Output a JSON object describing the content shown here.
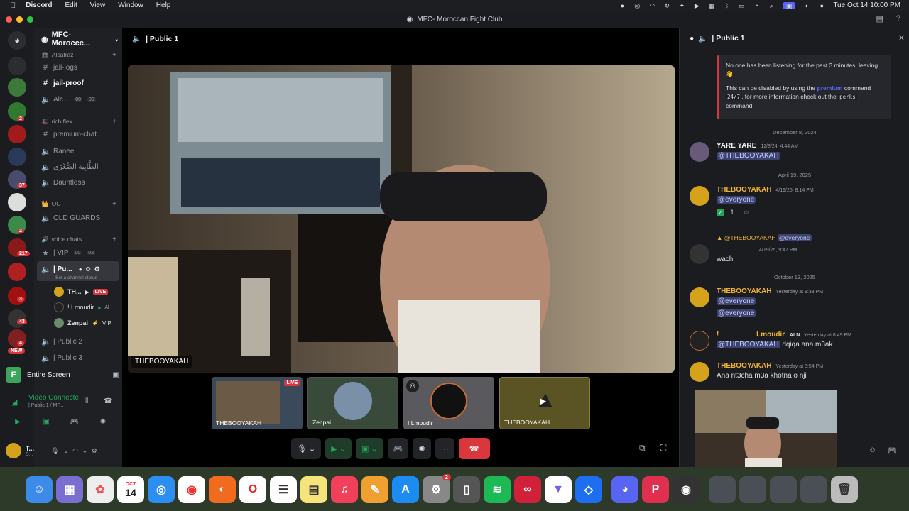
{
  "menubar": {
    "app": "Discord",
    "items": [
      "Edit",
      "View",
      "Window",
      "Help"
    ],
    "clock": "Tue Oct 14  10:00 PM"
  },
  "window": {
    "title": "MFC- Moroccan Fight Club"
  },
  "rail": {
    "badges": [
      "2",
      "37",
      "2",
      "217",
      "3",
      "43",
      "4"
    ],
    "new_label": "NEW"
  },
  "sidebar": {
    "server_name": "MFC- Moroccc...",
    "cat_alcatraz": "Alcatraz",
    "ch_jail_logs": "jail-logs",
    "ch_jail_proof": "jail-proof",
    "ch_alc": "Alc...",
    "ch_alc_n1": "00",
    "ch_alc_n2": "99",
    "cat_rich_flex": "rich flex",
    "ch_premium_chat": "premium-chat",
    "ch_ranee": "Ranee",
    "ch_arabic": "الطَّابِيَة الصُّغْرَىٰ",
    "ch_dauntless": "Dauntless",
    "cat_og": "OG",
    "ch_old_guards": "OLD GUARDS",
    "cat_voice": "voice chats",
    "ch_vip": "| VIP",
    "ch_vip_n1": "00",
    "ch_vip_n2": "02",
    "ch_public1": "| Pu...",
    "channel_status": "Set a channel status",
    "member1": "TH...",
    "live": "LIVE",
    "member2": "! Lmoudir",
    "member2_tag": "Al",
    "member3": "Zenpai",
    "member3_tag": "VIP",
    "ch_public2": "| Public 2",
    "ch_public3": "| Public 3"
  },
  "screen_share": {
    "label": "Entire Screen"
  },
  "voice": {
    "status": "Video Connecte",
    "location": "| Public 1 / MF..."
  },
  "user": {
    "name": "T...",
    "sub": "S..."
  },
  "stage": {
    "channel": "| Public 1",
    "main_label": "THEBOOYAKAH",
    "tiles": [
      {
        "name": "THEBOOYAKAH",
        "live": "LIVE"
      },
      {
        "name": "Zenpai"
      },
      {
        "name": "! Lmoudir"
      },
      {
        "name": "THEBOOYAKAH"
      }
    ]
  },
  "chat": {
    "channel": "| Public 1",
    "embed": {
      "line1": "No one has been listening for the past 3 minutes, leaving",
      "line2a": "This can be disabled by using the",
      "cmd": "premium",
      "line2b": "command",
      "code1": "24/7",
      "line3": ", for more information check out the",
      "code2": "perks",
      "line4": "command!"
    },
    "date1": "December 8, 2024",
    "m1_author": "YARE YARE",
    "m1_time": "12/8/24, 4:44 AM",
    "m1_text": "@THEBOOYAKAH",
    "date2": "April 19, 2025",
    "m2_author": "THEBOOYAKAH",
    "m2_time": "4/19/25, 8:14 PM",
    "m2_text": "@everyone",
    "m2_reaction": "1",
    "m3_reply_author": "@THEBOOYAKAH",
    "m3_reply_text": "@everyone",
    "m3_time": "4/19/25, 9:47 PM",
    "m3_text": "wach",
    "date3": "October 13, 2025",
    "m4_author": "THEBOOYAKAH",
    "m4_time": "Yesterday at 8:33 PM",
    "m4_text1": "@everyone",
    "m4_text2": "@everyone",
    "m5_author": "Lmoudir",
    "m5_tag": "ALN",
    "m5_time": "Yesterday at 8:49 PM",
    "m5_mention": "@THEBOOYAKAH",
    "m5_text": "dqiqa ana m3ak",
    "m6_author": "THEBOOYAKAH",
    "m6_time": "Yesterday at 8:54 PM",
    "m6_text": "Ana nt3cha m3a khotna o nji"
  },
  "dock": {
    "calendar_month": "OCT",
    "calendar_day": "14",
    "settings_badge": "2"
  },
  "colors": {
    "accent": "#5865f2",
    "danger": "#da373c",
    "online": "#23a55a",
    "gold": "#f0b232"
  }
}
